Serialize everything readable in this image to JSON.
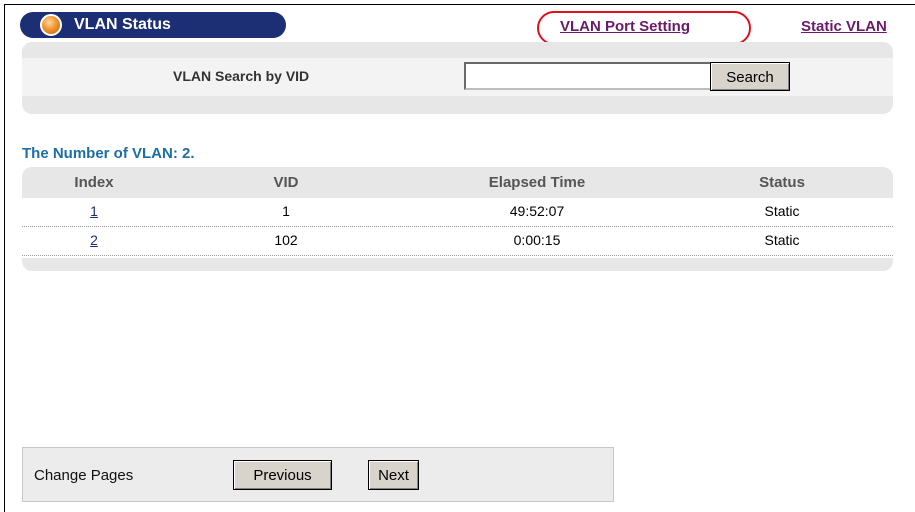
{
  "header": {
    "title": "VLAN Status",
    "link_port_setting": "VLAN Port Setting",
    "link_static_vlan": "Static VLAN"
  },
  "search": {
    "label": "VLAN Search by VID",
    "value": "",
    "button_label": "Search"
  },
  "summary": {
    "count_text": "The Number of VLAN: 2."
  },
  "table": {
    "headers": [
      "Index",
      "VID",
      "Elapsed Time",
      "Status"
    ],
    "rows": [
      {
        "index": "1",
        "vid": "1",
        "elapsed": "49:52:07",
        "status": "Static"
      },
      {
        "index": "2",
        "vid": "102",
        "elapsed": "0:00:15",
        "status": "Static"
      }
    ]
  },
  "pager": {
    "label": "Change Pages",
    "previous_label": "Previous",
    "next_label": "Next"
  },
  "colors": {
    "title_bg": "#1c2f74",
    "heading_blue": "#1b6ea6",
    "link_purple": "#6b1a6b",
    "highlight_red": "#e0101c"
  },
  "icons": {
    "title_orb": "orange-orb-icon"
  }
}
